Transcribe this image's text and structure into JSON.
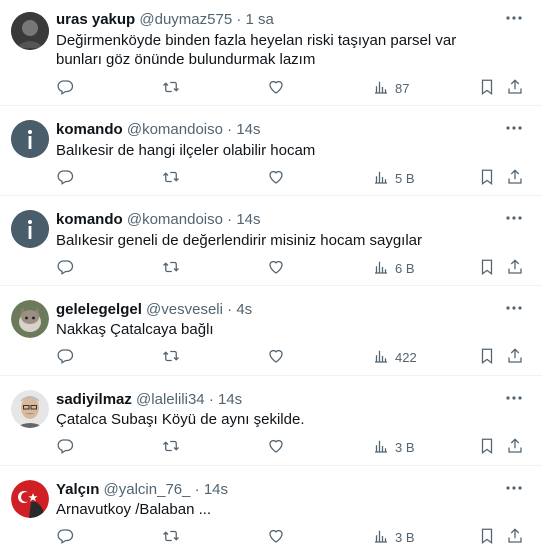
{
  "tweets": [
    {
      "name": "uras yakup",
      "handle": "@duymaz575",
      "time": "1 sa",
      "text": "Değirmenköyde binden fazla heyelan riski taşıyan parsel  var bunları göz önünde bulundurmak lazım",
      "views": "87",
      "avatar": "dark-photo-avatar"
    },
    {
      "name": "komando",
      "handle": "@komandoiso",
      "time": "14s",
      "text": "Balıkesir de hangi ilçeler olabilir hocam",
      "views": "5 B",
      "avatar": "default-avatar"
    },
    {
      "name": "komando",
      "handle": "@komandoiso",
      "time": "14s",
      "text": "Balıkesir geneli de değerlendirir misiniz hocam saygılar",
      "views": "6 B",
      "avatar": "default-avatar"
    },
    {
      "name": "gelelegelgel",
      "handle": "@vesveseli",
      "time": "4s",
      "text": "Nakkaş Çatalcaya bağlı",
      "views": "422",
      "avatar": "cat-photo-avatar"
    },
    {
      "name": "sadiyilmaz",
      "handle": "@lalelili34",
      "time": "14s",
      "text": "Çatalca Subaşı Köyü de aynı şekilde.",
      "views": "3 B",
      "avatar": "man-photo-avatar"
    },
    {
      "name": "Yalçın",
      "handle": "@yalcin_76_",
      "time": "14s",
      "text": "Arnavutkoy /Balaban ...",
      "views": "3 B",
      "avatar": "flag-avatar"
    }
  ],
  "dot": "·",
  "colors": {
    "muted": "#536471",
    "text": "#0f1419",
    "border": "#eff3f4"
  },
  "icons": [
    "reply-icon",
    "retweet-icon",
    "like-icon",
    "views-icon",
    "bookmark-icon",
    "share-icon",
    "more-icon"
  ]
}
